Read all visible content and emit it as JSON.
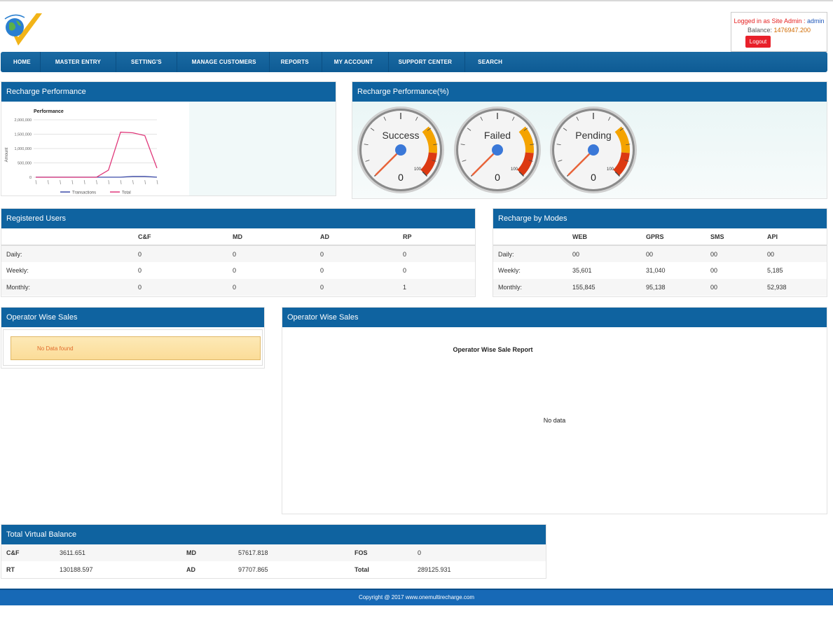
{
  "header": {
    "login_prefix": "Logged in as Site Admin : ",
    "login_user": "admin",
    "balance_label": "Balance: ",
    "balance_value": "1476947.200",
    "logout_label": "Logout"
  },
  "nav": {
    "items": [
      "HOME",
      "MASTER ENTRY",
      "SETTING'S",
      "MANAGE CUSTOMERS",
      "REPORTS",
      "MY ACCOUNT",
      "SUPPORT CENTER",
      "SEARCH"
    ]
  },
  "recharge_performance": {
    "title": "Recharge Performance",
    "chart_title": "Performance",
    "ylabel": "Amount",
    "y_ticks": [
      "2,000,000",
      "1,500,000",
      "1,000,000",
      "500,000",
      "0"
    ],
    "legend": [
      "Transactions",
      "Total"
    ]
  },
  "chart_data": {
    "type": "line",
    "title": "Performance",
    "ylabel": "Amount",
    "ylim": [
      0,
      2000000
    ],
    "series": [
      {
        "name": "Transactions",
        "color": "#3b4aa8",
        "values": [
          2000,
          2000,
          2000,
          2000,
          2000,
          2000,
          2000,
          2000,
          30000,
          30000,
          2000
        ]
      },
      {
        "name": "Total",
        "color": "#e0387a",
        "values": [
          0,
          0,
          0,
          0,
          0,
          0,
          250000,
          1570000,
          1550000,
          1450000,
          320000
        ]
      }
    ]
  },
  "recharge_performance_pct": {
    "title": "Recharge Performance(%)",
    "gauges": [
      {
        "label": "Success",
        "value": "0",
        "max": "100"
      },
      {
        "label": "Failed",
        "value": "0",
        "max": "100"
      },
      {
        "label": "Pending",
        "value": "0",
        "max": "100"
      }
    ]
  },
  "registered_users": {
    "title": "Registered Users",
    "columns": [
      "",
      "C&F",
      "MD",
      "AD",
      "RP"
    ],
    "rows": [
      [
        "Daily:",
        "0",
        "0",
        "0",
        "0"
      ],
      [
        "Weekly:",
        "0",
        "0",
        "0",
        "0"
      ],
      [
        "Monthly:",
        "0",
        "0",
        "0",
        "1"
      ]
    ]
  },
  "recharge_modes": {
    "title": "Recharge by Modes",
    "columns": [
      "",
      "WEB",
      "GPRS",
      "SMS",
      "API"
    ],
    "rows": [
      [
        "Daily:",
        "00",
        "00",
        "00",
        "00"
      ],
      [
        "Weekly:",
        "35,601",
        "31,040",
        "00",
        "5,185"
      ],
      [
        "Monthly:",
        "155,845",
        "95,138",
        "00",
        "52,938"
      ]
    ]
  },
  "operator_left": {
    "title": "Operator Wise Sales",
    "message": "No Data found"
  },
  "operator_right": {
    "title": "Operator Wise Sales",
    "report_title": "Operator Wise Sale Report",
    "no_data": "No data"
  },
  "virtual_balance": {
    "title": "Total Virtual Balance",
    "rows": [
      [
        "C&F",
        "3611.651",
        "MD",
        "57617.818",
        "FOS",
        "0"
      ],
      [
        "RT",
        "130188.597",
        "AD",
        "97707.865",
        "Total",
        "289125.931"
      ]
    ]
  },
  "footer": {
    "text": "Copyright @ 2017 www.onemultirecharge.com"
  }
}
